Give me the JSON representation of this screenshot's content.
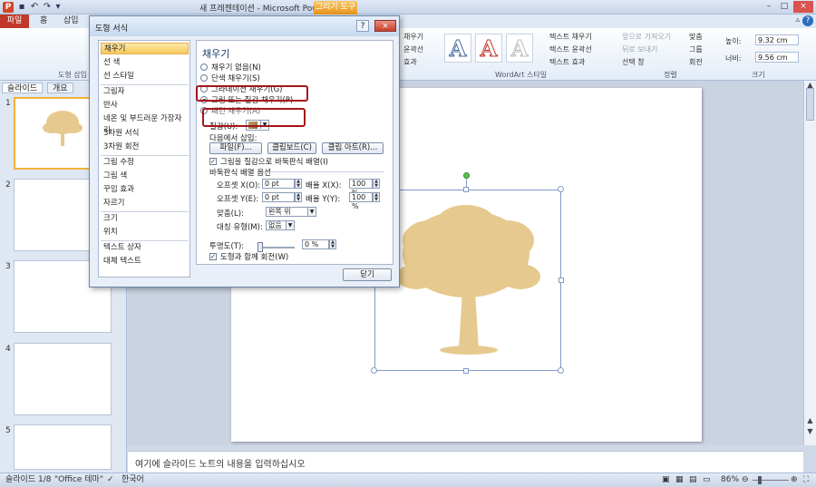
{
  "window": {
    "title": "새 프레젠테이션 - Microsoft PowerPoint",
    "tools_tab": "그리기 도구",
    "app_letter": "P"
  },
  "ribbon_tabs": {
    "file": "파일",
    "home": "홈",
    "insert": "삽입"
  },
  "ribbon": {
    "shape_insert_label": "도형 삽입",
    "wordart_styles_label": "WordArt 스타일",
    "arrange_label": "정렬",
    "size_label": "크기",
    "text_fill": "텍스트 채우기",
    "text_outline": "텍스트 윤곽선",
    "text_effects": "텍스트 효과",
    "fill_partial": "채우기",
    "outline_partial": "윤곽선",
    "effects_partial": "효과",
    "bring_forward": "앞으로 가져오기",
    "send_backward": "뒤로 보내기",
    "selection_pane": "선택 창",
    "align": "맞춤",
    "group": "그룹",
    "rotate": "회전",
    "height_label": "높이:",
    "height_value": "9.32 cm",
    "width_label": "너비:",
    "width_value": "9.56 cm",
    "wordart_letter": "A"
  },
  "left_panel": {
    "tab_slides": "슬라이드",
    "tab_outline": "개요",
    "close": "×",
    "slide_numbers": [
      "1",
      "2",
      "3",
      "4",
      "5"
    ]
  },
  "dialog": {
    "title": "도형 서식",
    "help": "?",
    "close": "×",
    "nav": [
      "채우기",
      "선 색",
      "선 스타일",
      "그림자",
      "반사",
      "네온 및 부드러운 가장자리",
      "3차원 서식",
      "3차원 회전",
      "그림 수정",
      "그림 색",
      "꾸밈 효과",
      "자르기",
      "크기",
      "위치",
      "텍스트 상자",
      "대체 텍스트"
    ],
    "heading": "채우기",
    "radios": [
      "채우기 없음(N)",
      "단색 채우기(S)",
      "그라데이션 채우기(G)",
      "그림 또는 질감 채우기(P)",
      "패턴 채우기(A)"
    ],
    "texture_label": "질감(U):",
    "insert_from": "다음에서 삽입:",
    "btn_file": "파일(F)...",
    "btn_clipboard": "클립보드(C)",
    "btn_clipart": "클립 아트(R)...",
    "tile_check": "그림을 질감으로 바둑판식 배열(I)",
    "tile_options": "바둑판식 배열 옵션",
    "offset_x_label": "오프셋 X(O):",
    "offset_x_value": "0 pt",
    "offset_y_label": "오프셋 Y(E):",
    "offset_y_value": "0 pt",
    "scale_x_label": "배율 X(X):",
    "scale_x_value": "100 %",
    "scale_y_label": "배율 Y(Y):",
    "scale_y_value": "100 %",
    "align_label": "맞춤(L):",
    "align_value": "왼쪽 위",
    "mirror_label": "대칭 유형(M):",
    "mirror_value": "없음",
    "transparency_label": "투명도(T):",
    "transparency_value": "0 %",
    "rotate_check": "도형과 함께 회전(W)",
    "ok_button": "닫기"
  },
  "notes": {
    "placeholder": "여기에 슬라이드 노트의 내용을 입력하십시오"
  },
  "status_bar": {
    "slide_info": "슬라이드 1/8",
    "theme": "\"Office 테마\"",
    "language": "한국어",
    "zoom": "86%"
  },
  "colors": {
    "accent_file_tab": "#c0392b",
    "tools_tab": "#e9951b",
    "highlight": "#a4161a",
    "tree": "#e6c98f"
  }
}
